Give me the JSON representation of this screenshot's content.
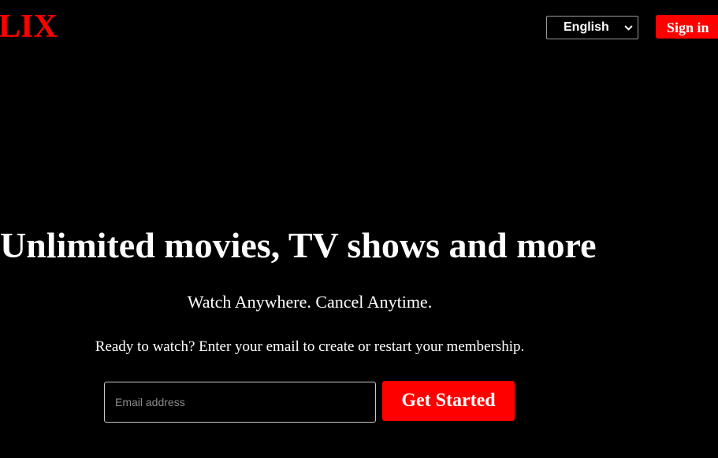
{
  "header": {
    "logo_text": "LIX",
    "language_select": {
      "selected": "English"
    },
    "signin_label": "Sign in"
  },
  "hero": {
    "title": "Unlimited movies, TV shows and more",
    "subtitle": "Watch Anywhere. Cancel Anytime.",
    "prompt": "Ready to watch? Enter your email to create or restart your membership.",
    "email": {
      "value": "",
      "placeholder": "Email address"
    },
    "cta_label": "Get Started"
  },
  "colors": {
    "background": "#000000",
    "brand_red": "#ff0000",
    "text": "#ffffff"
  },
  "icons": {
    "language_dropdown": "chevron-down-icon"
  }
}
